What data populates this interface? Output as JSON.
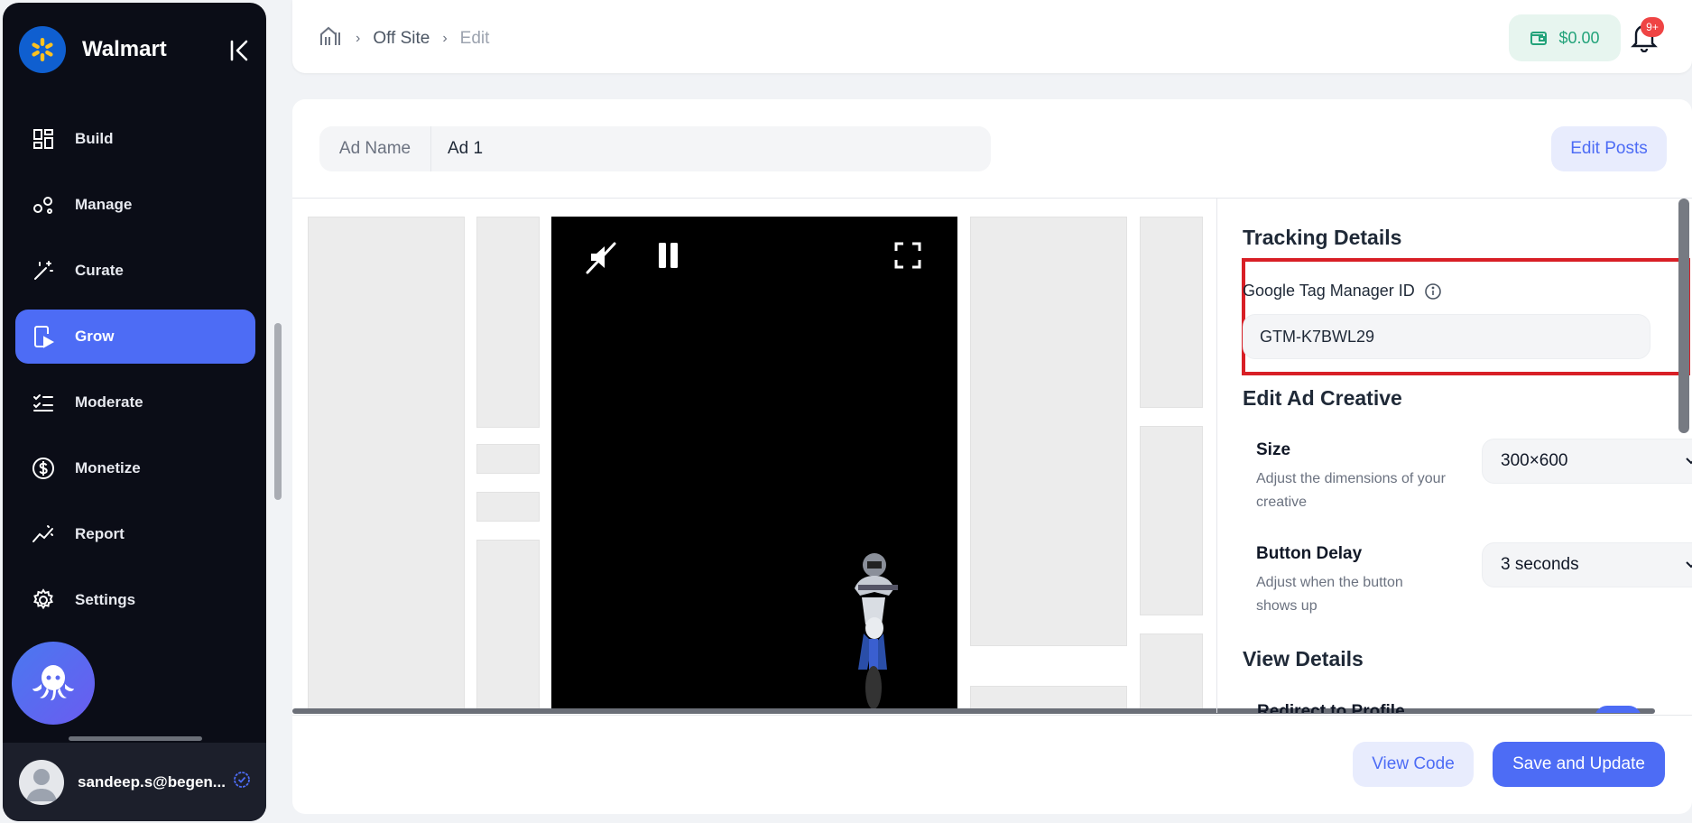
{
  "brand": {
    "name": "Walmart",
    "color": "#0f5fd0"
  },
  "sidebar": {
    "items": [
      {
        "label": "Build",
        "icon": "grid-icon"
      },
      {
        "label": "Manage",
        "icon": "nodes-icon"
      },
      {
        "label": "Curate",
        "icon": "magic-wand-icon"
      },
      {
        "label": "Grow",
        "icon": "grow-play-icon",
        "active": true
      },
      {
        "label": "Moderate",
        "icon": "checklist-icon"
      },
      {
        "label": "Monetize",
        "icon": "dollar-circle-icon"
      },
      {
        "label": "Report",
        "icon": "trend-icon"
      },
      {
        "label": "Settings",
        "icon": "gear-icon"
      }
    ],
    "accent": "#4d6cf5"
  },
  "user": {
    "email": "sandeep.s@begen..."
  },
  "breadcrumb": {
    "section": "Off Site",
    "current": "Edit"
  },
  "wallet": {
    "balance": "$0.00"
  },
  "notifications": {
    "badge": "9+"
  },
  "ad": {
    "name_label": "Ad Name",
    "name_value": "Ad 1"
  },
  "actions": {
    "edit_posts": "Edit Posts",
    "view_code": "View Code",
    "save": "Save and Update"
  },
  "tracking": {
    "title": "Tracking Details",
    "gtm_label": "Google Tag Manager ID",
    "gtm_value": "GTM-K7BWL29"
  },
  "creative": {
    "title": "Edit Ad Creative",
    "size": {
      "label": "Size",
      "desc": "Adjust the dimensions of your creative",
      "value": "300×600"
    },
    "delay": {
      "label": "Button Delay",
      "desc": "Adjust when the button shows up",
      "value": "3 seconds"
    }
  },
  "view_details": {
    "title": "View Details",
    "redirect_label": "Redirect to Profile"
  }
}
